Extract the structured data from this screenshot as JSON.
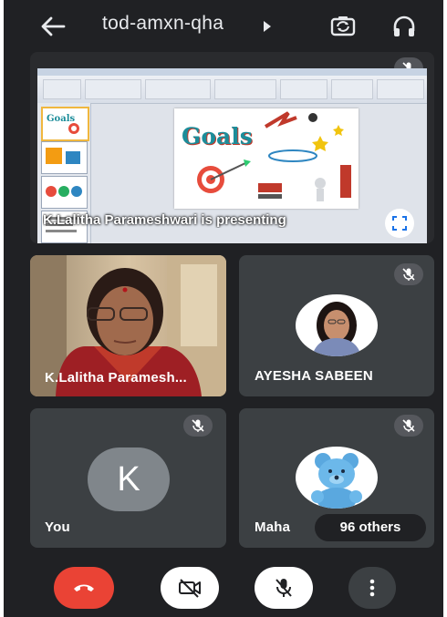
{
  "meeting": {
    "code": "tod-amxn-qha"
  },
  "presentation": {
    "label": "K.Lalitha Parameshwari is presenting",
    "slide_title": "Goals"
  },
  "participants": [
    {
      "name": "K.Lalitha Paramesh...",
      "muted": false
    },
    {
      "name": "AYESHA SABEEN",
      "muted": true
    },
    {
      "name": "You",
      "initial": "K",
      "muted": true
    },
    {
      "name": "Maha",
      "muted": true
    }
  ],
  "others": {
    "label": "96 others"
  },
  "colors": {
    "background": "#202124",
    "tile": "#3c4043",
    "end_call": "#ea4335",
    "avatar_grey": "#80868b"
  },
  "icons": {
    "back": "arrow-left-icon",
    "camera_switch": "camera-switch-icon",
    "audio": "headphones-icon",
    "end_call": "phone-hangup-icon",
    "camera": "camera-off-icon",
    "mic": "mic-off-icon",
    "more": "more-vert-icon",
    "fullscreen": "fullscreen-icon"
  }
}
